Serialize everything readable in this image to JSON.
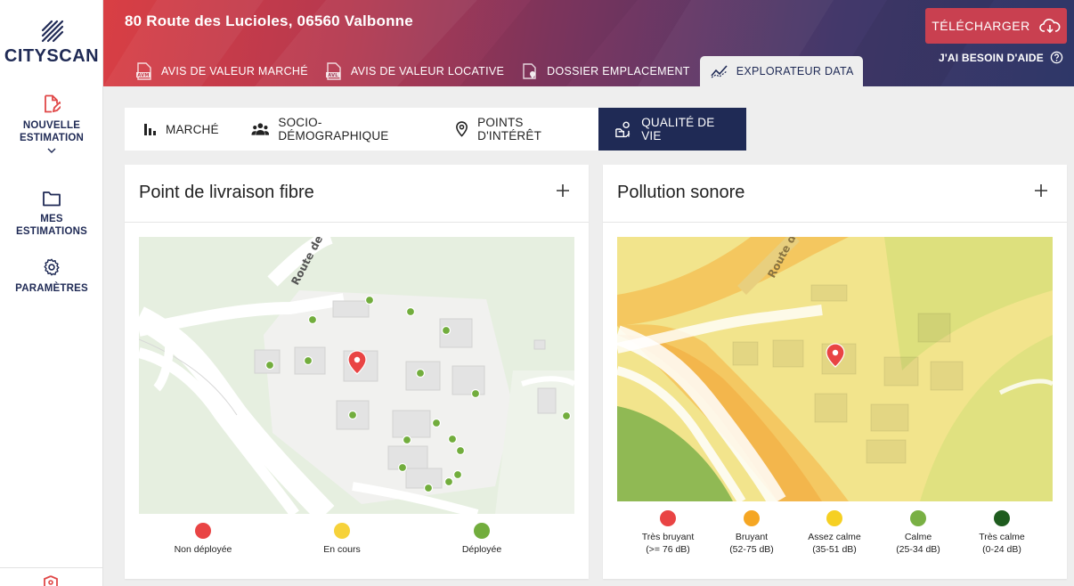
{
  "app": {
    "logo_text": "CITYSCAN",
    "address": "80 Route des Lucioles, 06560 Valbonne"
  },
  "sidebar": {
    "items": [
      {
        "label_1": "NOUVELLE",
        "label_2": "ESTIMATION",
        "icon": "edit-document-icon"
      },
      {
        "label_1": "MES",
        "label_2": "ESTIMATIONS",
        "icon": "folder-icon"
      },
      {
        "label_1": "PARAMÈTRES",
        "label_2": "",
        "icon": "gear-icon"
      }
    ]
  },
  "header": {
    "download_label": "TÉLÉCHARGER",
    "help_label": "J'AI BESOIN D'AIDE",
    "tabs": [
      {
        "label": "AVIS DE VALEUR MARCHÉ",
        "icon": "avm-document-icon",
        "active": false
      },
      {
        "label": "AVIS DE VALEUR LOCATIVE",
        "icon": "avl-document-icon",
        "active": false
      },
      {
        "label": "DOSSIER EMPLACEMENT",
        "icon": "location-document-icon",
        "active": false
      },
      {
        "label": "EXPLORATEUR DATA",
        "icon": "chart-line-icon",
        "active": true
      }
    ]
  },
  "subtabs": [
    {
      "label": "MARCHÉ",
      "icon": "bar-chart-icon",
      "active": false
    },
    {
      "label": "SOCIO-DÉMOGRAPHIQUE",
      "icon": "people-icon",
      "active": false
    },
    {
      "label": "POINTS D'INTÉRÊT",
      "icon": "map-pin-icon",
      "active": false
    },
    {
      "label": "QUALITÉ DE VIE",
      "icon": "quality-of-life-icon",
      "active": true
    }
  ],
  "cards": [
    {
      "title": "Point de livraison fibre",
      "map_labels": {
        "road": "Route de"
      },
      "legend": [
        {
          "label": "Non déployée",
          "label_2": "",
          "color": "#e94444"
        },
        {
          "label": "En cours",
          "label_2": "",
          "color": "#f6d23a"
        },
        {
          "label": "Déployée",
          "label_2": "",
          "color": "#72ad3d"
        }
      ]
    },
    {
      "title": "Pollution sonore",
      "map_labels": {
        "road": "Route d"
      },
      "legend": [
        {
          "label": "Très bruyant",
          "label_2": "(>= 76 dB)",
          "color": "#e94444"
        },
        {
          "label": "Bruyant",
          "label_2": "(52-75 dB)",
          "color": "#f5a623"
        },
        {
          "label": "Assez calme",
          "label_2": "(35-51 dB)",
          "color": "#f6d023"
        },
        {
          "label": "Calme",
          "label_2": "(25-34 dB)",
          "color": "#79b044"
        },
        {
          "label": "Très calme",
          "label_2": "(0-24 dB)",
          "color": "#1f5c1f"
        }
      ]
    }
  ],
  "colors": {
    "navy": "#1f2a55",
    "accent_red": "#e04848",
    "header_gradient_start": "#d93f44",
    "header_gradient_end": "#2e3768"
  }
}
